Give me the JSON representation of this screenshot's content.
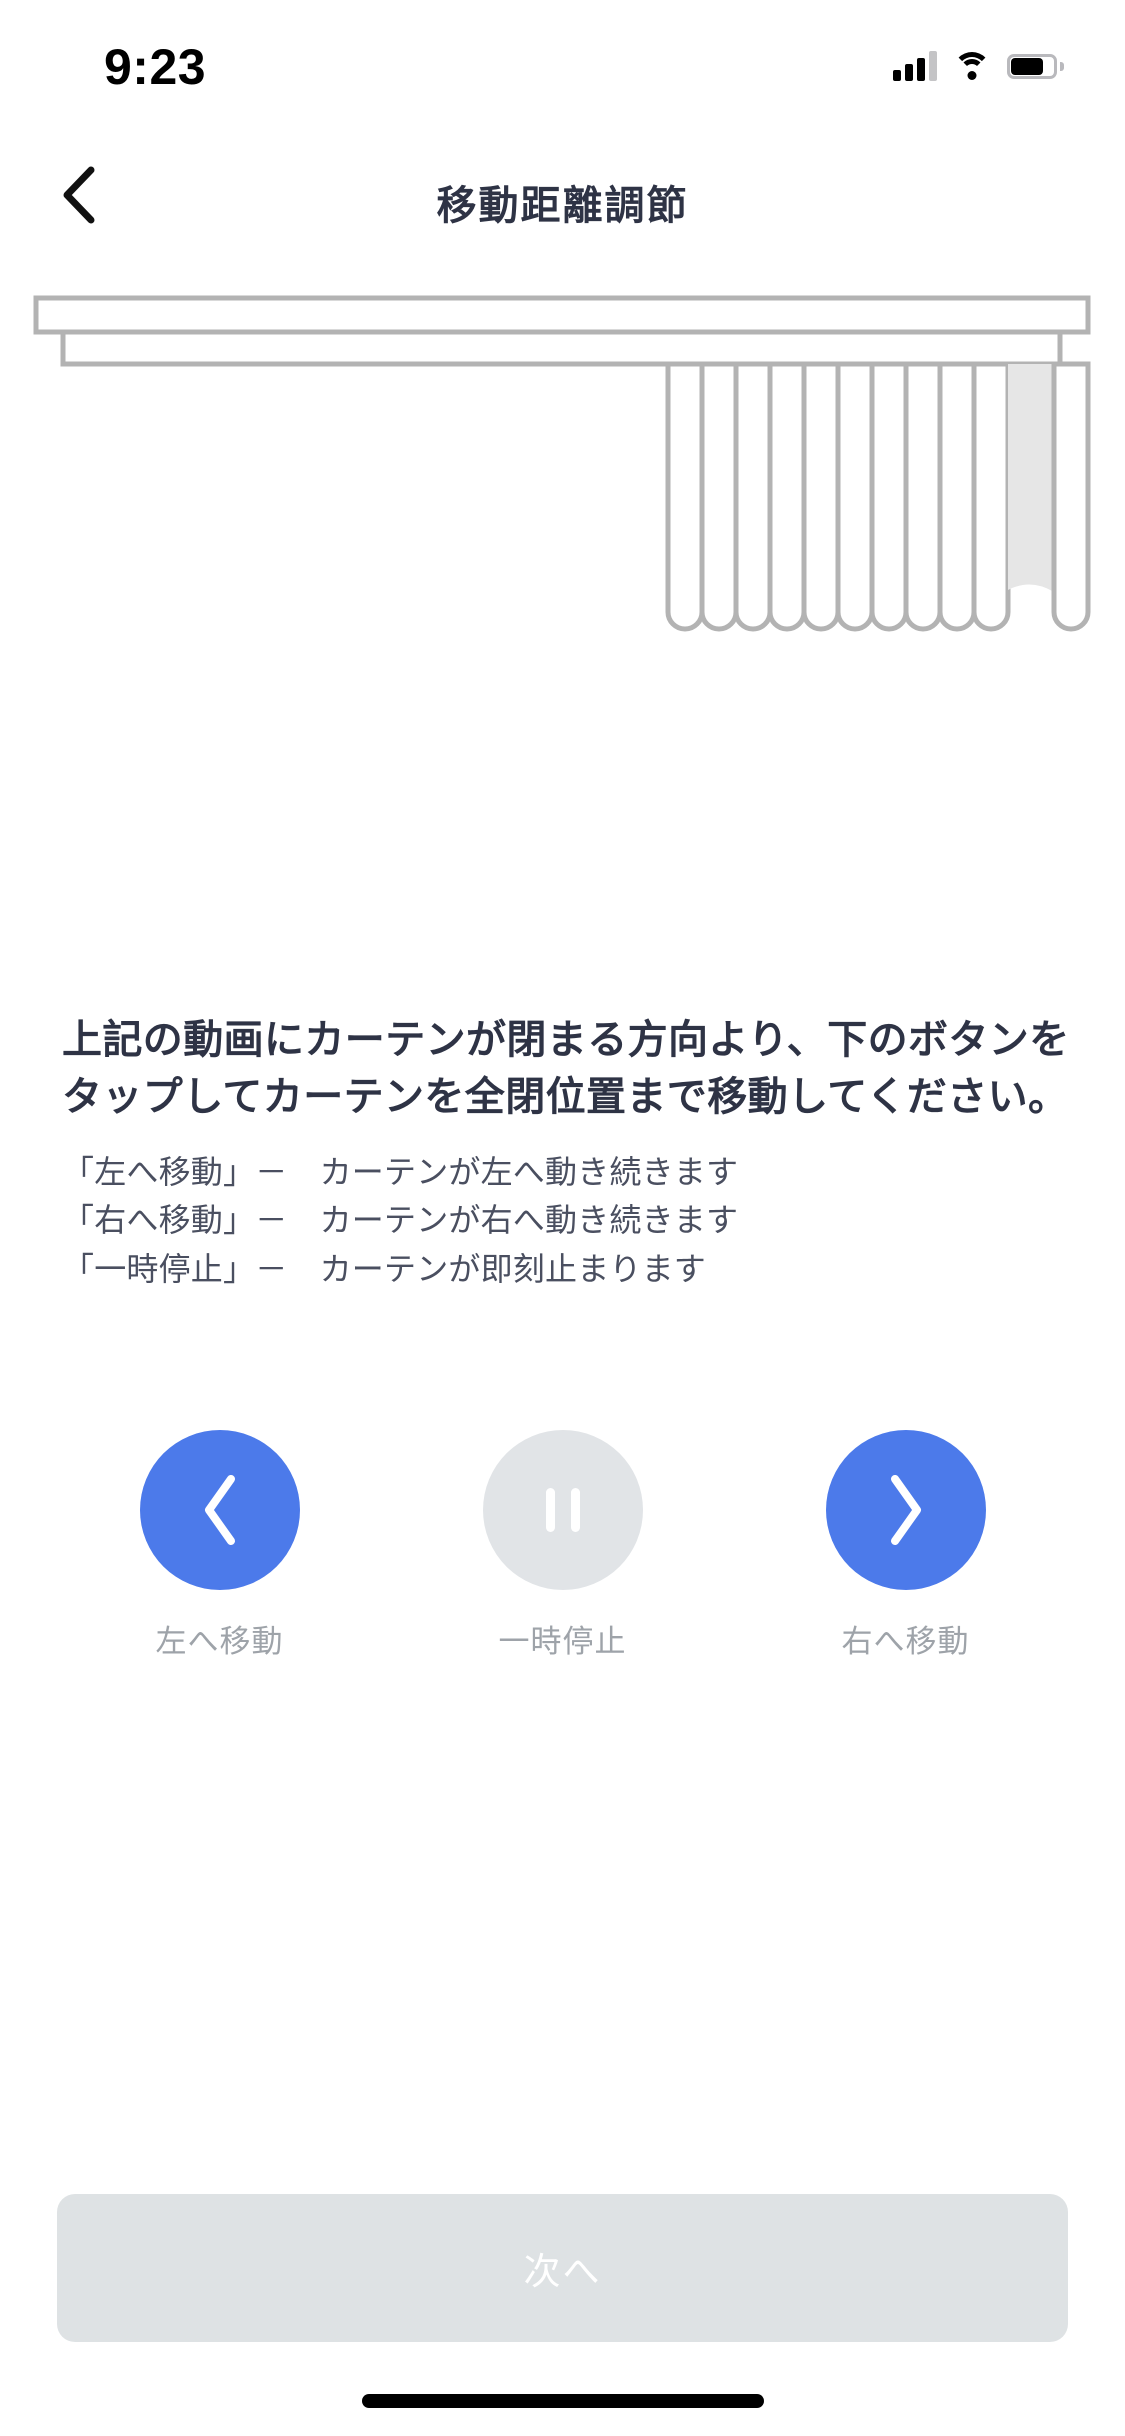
{
  "status_bar": {
    "time": "9:23",
    "cellular_icon": "signal-bars-icon",
    "wifi_icon": "wifi-icon",
    "battery_icon": "battery-icon"
  },
  "nav": {
    "back_icon": "chevron-left-icon",
    "title": "移動距離調節"
  },
  "illustration": {
    "name": "curtain-animation-preview",
    "rail_color": "#b3b3b3",
    "pleat_color": "#b0b0b0",
    "highlight_color": "#e6e6e6",
    "pleat_count": 12,
    "highlighted_pleat_index": 10
  },
  "copy": {
    "headline": "上記の動画にカーテンが閉まる方向より、下のボタンをタップしてカーテンを全閉位置まで移動してください。",
    "bullets": [
      "「左へ移動」－　カーテンが左へ動き続きます",
      "「右へ移動」－　カーテンが右へ動き続きます",
      "「一時停止」－　カーテンが即刻止まります"
    ]
  },
  "controls": [
    {
      "id": "move-left",
      "icon": "chevron-left-icon",
      "label": "左へ移動",
      "style": "blue",
      "color": "#4c7aea",
      "enabled": true
    },
    {
      "id": "pause",
      "icon": "pause-icon",
      "label": "一時停止",
      "style": "grey",
      "color": "#e1e4e7",
      "enabled": false
    },
    {
      "id": "move-right",
      "icon": "chevron-right-icon",
      "label": "右へ移動",
      "style": "blue",
      "color": "#4c7aea",
      "enabled": true
    }
  ],
  "primary_button": {
    "label": "次へ",
    "enabled": false,
    "background": "#dee2e4",
    "text_color": "#ffffff"
  },
  "colors": {
    "accent": "#4c7aea",
    "title": "#2e3345",
    "body_text": "#4a4f60",
    "muted_text": "#9ea3a9",
    "background": "#ffffff"
  }
}
